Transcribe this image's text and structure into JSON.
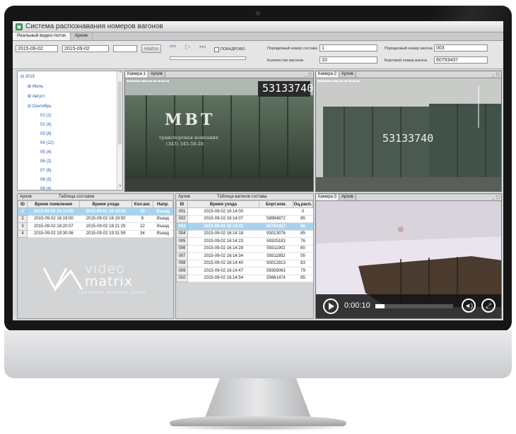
{
  "app": {
    "title": "Система распознавания номеров вагонов",
    "icon": "app-logo-icon"
  },
  "tabs": [
    {
      "label": "Реальный видео-поток"
    },
    {
      "label": "Архив"
    }
  ],
  "toolbar": {
    "date_from": "2015-09-02",
    "date_to": "2015-09-02",
    "extra_value": "",
    "find_label": "Найти",
    "reverse_label": "ПОКАДРОВО",
    "composition_no_label": "Порядковый номер состава",
    "composition_no_value": "1",
    "wagon_count_label": "Количество вагонов",
    "wagon_count_value": "10",
    "wagon_order_label": "Порядковый номер вагона",
    "wagon_order_value": "003",
    "board_no_label": "Бортовой номер вагона",
    "board_no_value": "60793437"
  },
  "tree": {
    "root": "2015",
    "items": [
      "Июль",
      "Август",
      "Сентябрь"
    ],
    "days": [
      "01 (1)",
      "02 (4)",
      "03 (8)",
      "04 (12)",
      "05 (4)",
      "06 (2)",
      "07 (6)",
      "08 (5)",
      "09 (4)"
    ]
  },
  "cameras": {
    "cam1": {
      "tab": "Камера 1",
      "archive": "Архив",
      "plate": "53133740",
      "text1": "МВТ",
      "text2": "транспортная компания",
      "text3": "(343) 345-58-28"
    },
    "cam2": {
      "tab": "Камера 2",
      "archive": "Архив",
      "plate": "53133740"
    },
    "cam3": {
      "tab": "Камера 3",
      "archive": "Архив",
      "time": "0:00:10",
      "progress": 0.12
    }
  },
  "compositions": {
    "tab": "Архив",
    "title": "Таблица составов",
    "columns": [
      "ID",
      "Время появления",
      "Время ухода",
      "Кол.ваг.",
      "Напр."
    ],
    "rows": [
      [
        "1",
        "2015-09-02 16:14:00",
        "2015-09-02 16:19:54",
        "10",
        "Въезд"
      ],
      [
        "2",
        "2015-09-02 16:19:00",
        "2015-09-02 16:19:50",
        "6",
        "Въезд"
      ],
      [
        "3",
        "2015-09-02 18:20:07",
        "2015-09-02 18:21:29",
        "22",
        "Въезд"
      ],
      [
        "4",
        "2015-09-02 19:30:06",
        "2015-09-02 19:31:59",
        "34",
        "Въезд"
      ]
    ],
    "selected": 0
  },
  "wagons": {
    "tab": "Архив",
    "title": "Таблица вагонов состава",
    "columns": [
      "ID",
      "Время ухода",
      "Борт.ном.",
      "Оц.расп."
    ],
    "rows": [
      [
        "001",
        "2015-09-02 16:14:00",
        "",
        "0"
      ],
      [
        "002",
        "2015-09-02 16:14:07",
        "58994872",
        "85"
      ],
      [
        "003",
        "2015-09-02 16:14:11",
        "60793437",
        "86"
      ],
      [
        "004",
        "2015-09-02 16:14:18",
        "93013076",
        "85"
      ],
      [
        "005",
        "2015-09-02 16:14:23",
        "59325183",
        "76"
      ],
      [
        "006",
        "2015-09-02 16:14:28",
        "59311902",
        "80"
      ],
      [
        "007",
        "2015-09-02 16:14:34",
        "59311852",
        "55"
      ],
      [
        "008",
        "2015-09-02 16:14:40",
        "93012813",
        "83"
      ],
      [
        "009",
        "2015-09-02 16:14:47",
        "59356063",
        "79"
      ],
      [
        "010",
        "2015-09-02 16:14:54",
        "55661474",
        "85"
      ]
    ],
    "selected": 2
  },
  "logo": {
    "line1": "video",
    "line2": "matrix",
    "tagline": "industrial machine vision"
  }
}
